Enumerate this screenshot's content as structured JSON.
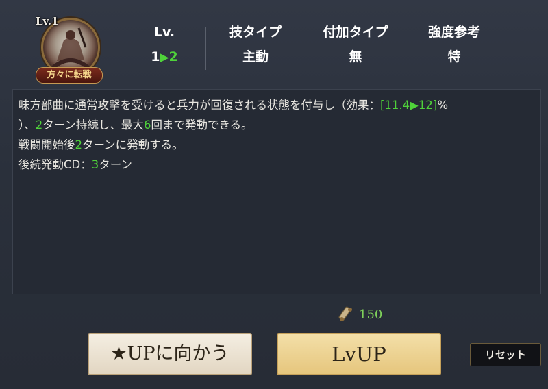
{
  "skill": {
    "level_tag": "Lv.1",
    "name": "方々に転戦"
  },
  "stats": [
    {
      "label": "Lv.",
      "value_from": "1",
      "value_to": "2"
    },
    {
      "label": "技タイプ",
      "value": "主動"
    },
    {
      "label": "付加タイプ",
      "value": "無"
    },
    {
      "label": "強度参考",
      "value": "特"
    }
  ],
  "description": {
    "line1_a": "味方部曲に通常攻撃を受けると兵力が回復される状態を付与し（効果：",
    "line1_hl": "[11.4▶12]",
    "line1_b": "%",
    "line2_a": "）、",
    "line2_hl1": "2",
    "line2_b": "ターン持続し、最大",
    "line2_hl2": "6",
    "line2_c": "回まで発動できる。",
    "line3_a": "戦闘開始後",
    "line3_hl": "2",
    "line3_b": "ターンに発動する。",
    "line4_a": "後続発動CD：",
    "line4_hl": "3",
    "line4_b": "ターン"
  },
  "cost": {
    "icon": "scroll-icon",
    "value": "150"
  },
  "buttons": {
    "star_up": "★UPに向かう",
    "lv_up": "LvUP",
    "reset": "リセット"
  },
  "colors": {
    "highlight": "#4fd23a",
    "background": "#2c323e",
    "lvup_button": "#e6c67d"
  }
}
